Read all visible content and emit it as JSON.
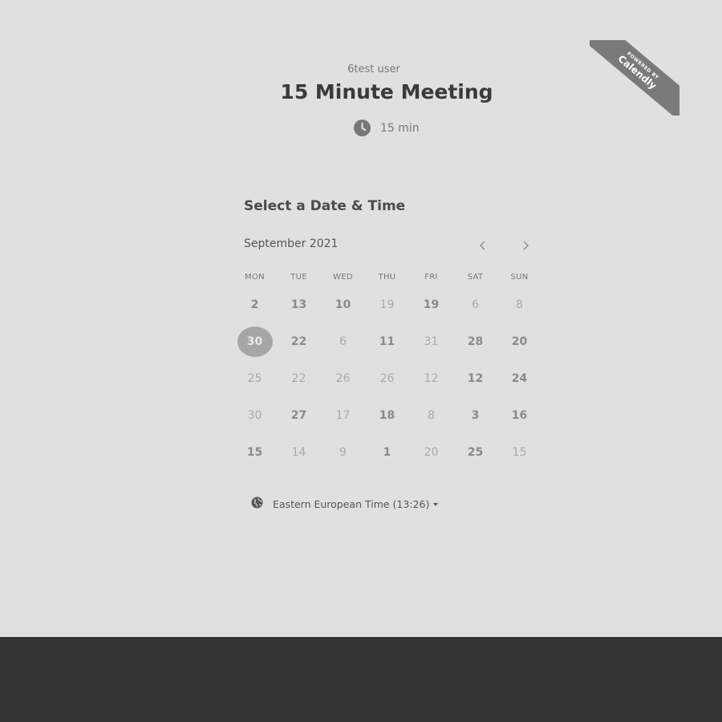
{
  "badge": {
    "small_text": "POWERED BY",
    "brand": "Calendly"
  },
  "header": {
    "organizer": "6test user",
    "event_title": "15 Minute Meeting",
    "duration": "15 min",
    "duration_icon": "clock-icon"
  },
  "calendar": {
    "heading": "Select a Date & Time",
    "month": "September 2021",
    "prev_icon": "chevron-left-icon",
    "next_icon": "chevron-right-icon",
    "weekdays": [
      "MON",
      "TUE",
      "WED",
      "THU",
      "FRI",
      "SAT",
      "SUN"
    ],
    "weeks": [
      [
        {
          "d": "2",
          "a": true
        },
        {
          "d": "13",
          "a": true
        },
        {
          "d": "10",
          "a": true
        },
        {
          "d": "19",
          "a": false
        },
        {
          "d": "19",
          "a": true
        },
        {
          "d": "6",
          "a": false
        },
        {
          "d": "8",
          "a": false
        }
      ],
      [
        {
          "d": "30",
          "a": true,
          "s": true
        },
        {
          "d": "22",
          "a": true
        },
        {
          "d": "6",
          "a": false
        },
        {
          "d": "11",
          "a": true
        },
        {
          "d": "31",
          "a": false
        },
        {
          "d": "28",
          "a": true
        },
        {
          "d": "20",
          "a": true
        }
      ],
      [
        {
          "d": "25",
          "a": false
        },
        {
          "d": "22",
          "a": false
        },
        {
          "d": "26",
          "a": false
        },
        {
          "d": "26",
          "a": false
        },
        {
          "d": "12",
          "a": false
        },
        {
          "d": "12",
          "a": true
        },
        {
          "d": "24",
          "a": true
        }
      ],
      [
        {
          "d": "30",
          "a": false
        },
        {
          "d": "27",
          "a": true
        },
        {
          "d": "17",
          "a": false
        },
        {
          "d": "18",
          "a": true
        },
        {
          "d": "8",
          "a": false
        },
        {
          "d": "3",
          "a": true
        },
        {
          "d": "16",
          "a": true
        }
      ],
      [
        {
          "d": "15",
          "a": true
        },
        {
          "d": "14",
          "a": false
        },
        {
          "d": "9",
          "a": false
        },
        {
          "d": "1",
          "a": true
        },
        {
          "d": "20",
          "a": false
        },
        {
          "d": "25",
          "a": true
        },
        {
          "d": "15",
          "a": false
        }
      ]
    ]
  },
  "timezone": {
    "label": "Eastern European Time (13:26)",
    "icon": "globe-icon"
  },
  "colors": {
    "background": "#e0e0e0",
    "footer": "#333333",
    "selected_day": "#a6a6a6",
    "badge": "#7a7a7a"
  }
}
